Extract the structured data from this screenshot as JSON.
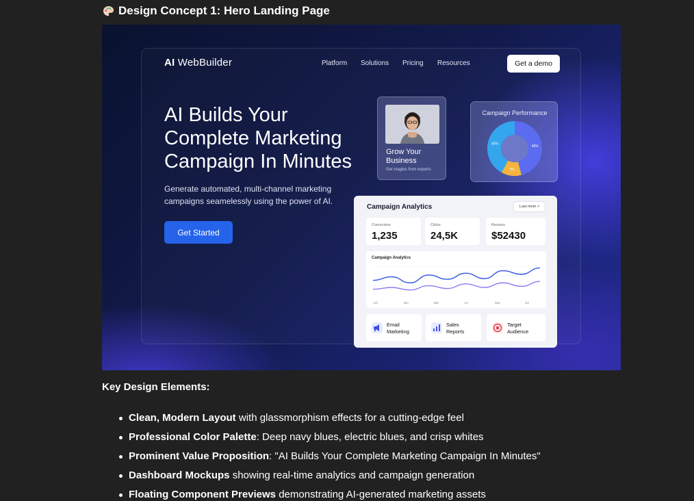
{
  "heading": {
    "icon": "palette-icon",
    "text": "Design Concept 1: Hero Landing Page"
  },
  "hero": {
    "logo": {
      "prefix": "AI",
      "name": "WebBuilder"
    },
    "nav": [
      "Platform",
      "Solutions",
      "Pricing",
      "Resources"
    ],
    "demo_button": "Get a demo",
    "title_lines": [
      "AI Builds Your",
      "Complete Marketing",
      "Campaign In Minutes"
    ],
    "subtitle_lines": [
      "Generate automated, multi-channel marketing",
      "campaigns seamelessly using the power of AI."
    ],
    "cta": "Get Started",
    "grow_card": {
      "title_lines": [
        "Grow Your",
        "Business"
      ],
      "sub": "Get magles from exports"
    },
    "performance_card": {
      "title": "Campaign Performance",
      "chart_data": {
        "type": "pie",
        "slices": [
          {
            "label": "46%",
            "value": 46,
            "color": "#5b6cf0"
          },
          {
            "label": "5%",
            "value": 12,
            "color": "#f3b440"
          },
          {
            "label": "45%",
            "value": 42,
            "color": "#33a6ee"
          }
        ]
      }
    },
    "analytics_card": {
      "title": "Campaign Analytics",
      "period_button": "Last mom >",
      "stats": [
        {
          "label": "Conrocions",
          "value": "1,235"
        },
        {
          "label": "Clicks",
          "value": "24,5K"
        },
        {
          "label": "Revious",
          "value": "$52430"
        }
      ],
      "chart": {
        "title": "Campaign Analytics",
        "chart_data": {
          "type": "line",
          "x": [
            "Arlt",
            "Jbn",
            "Mlo",
            "Arl",
            "Nep",
            "Jbi"
          ],
          "series": [
            {
              "color": "#2f54e8",
              "values": [
                45,
                55,
                38,
                60,
                48,
                65,
                50,
                72,
                62,
                80
              ]
            },
            {
              "color": "#8b7cf2",
              "values": [
                20,
                25,
                18,
                30,
                22,
                35,
                25,
                38,
                28,
                42
              ]
            }
          ]
        }
      },
      "tiles": [
        {
          "icon": "megaphone-icon",
          "lines": [
            "Email",
            "Marketing"
          ]
        },
        {
          "icon": "bar-chart-icon",
          "lines": [
            "Sales",
            "Reports"
          ]
        },
        {
          "icon": "target-icon",
          "lines": [
            "Target",
            "Audience"
          ]
        }
      ]
    }
  },
  "key_elements": {
    "title": "Key Design Elements:",
    "items": [
      {
        "bold": "Clean, Modern Layout",
        "rest": " with glassmorphism effects for a cutting-edge feel"
      },
      {
        "bold": "Professional Color Palette",
        "rest": ": Deep navy blues, electric blues, and crisp whites"
      },
      {
        "bold": "Prominent Value Proposition",
        "rest": ": \"AI Builds Your Complete Marketing Campaign In Minutes\""
      },
      {
        "bold": "Dashboard Mockups",
        "rest": " showing real-time analytics and campaign generation"
      },
      {
        "bold": "Floating Component Previews",
        "rest": " demonstrating AI-generated marketing assets"
      }
    ]
  }
}
